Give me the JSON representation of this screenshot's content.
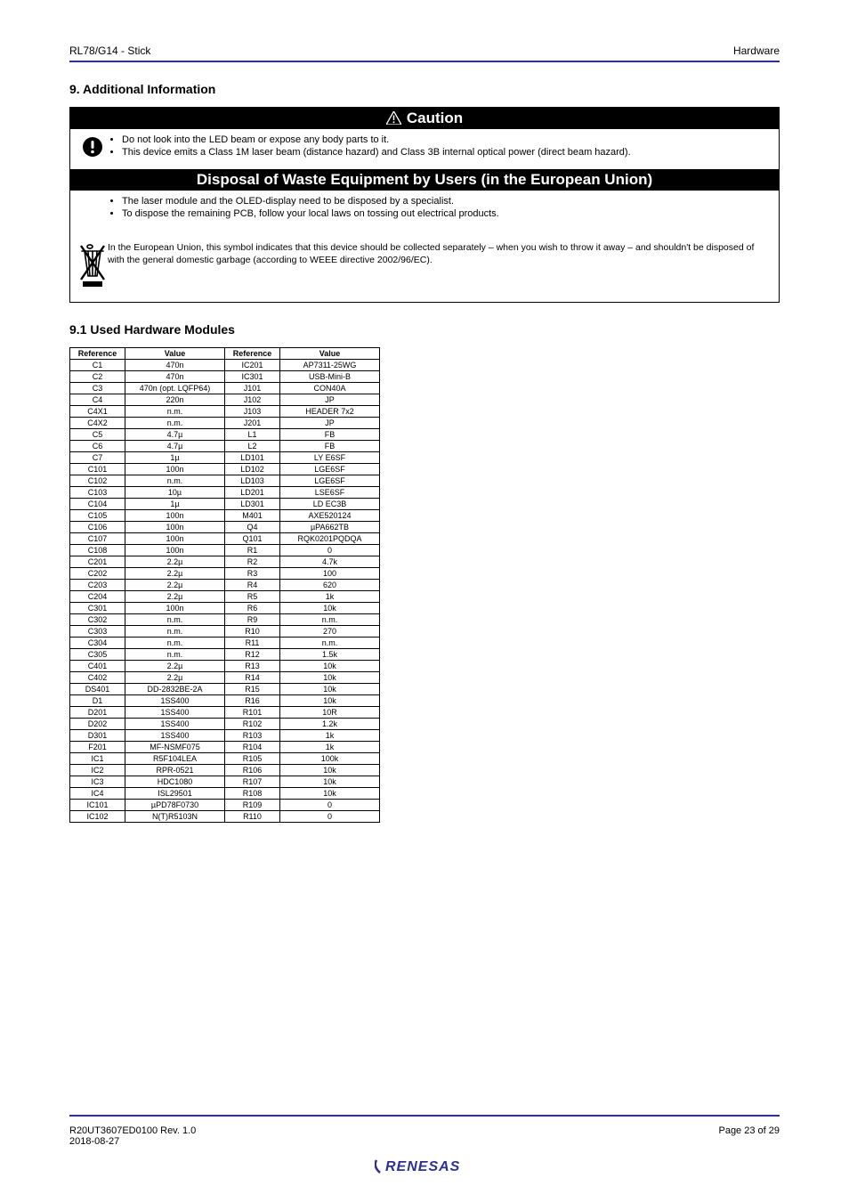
{
  "header": {
    "left": "RL78/G14 - Stick",
    "right": "Hardware"
  },
  "section9": {
    "title": "9. Additional Information",
    "caution_bar": "Caution",
    "caution_items": [
      "Do not look into the LED beam or expose any body parts to it.",
      "This device emits a Class 1M laser beam (distance hazard) and Class 3B internal optical power (direct beam hazard)."
    ],
    "disposal_bar": "Disposal of Waste Equipment by Users (in the European Union)",
    "disposal_items": [
      "The laser module and the OLED-display need to be disposed by a specialist.",
      "To dispose the remaining PCB, follow your local laws on tossing out electrical products."
    ],
    "weee_text": "In the European Union, this symbol indicates that this device should be collected separately – when you wish to throw it away – and shouldn't be disposed of with the general domestic garbage (according to WEEE directive 2002/96/EC)."
  },
  "section91": {
    "title": "9.1 Used Hardware Modules",
    "table_head": [
      "Reference",
      "Value",
      "Reference",
      "Value"
    ],
    "rows": [
      [
        "C1",
        "470n",
        "IC201",
        "AP7311-25WG"
      ],
      [
        "C2",
        "470n",
        "IC301",
        "USB-Mini-B"
      ],
      [
        "C3",
        "470n (opt. LQFP64)",
        "J101",
        "CON40A"
      ],
      [
        "C4",
        "220n",
        "J102",
        "JP"
      ],
      [
        "C4X1",
        "n.m.",
        "J103",
        "HEADER 7x2"
      ],
      [
        "C4X2",
        "n.m.",
        "J201",
        "JP"
      ],
      [
        "C5",
        "4.7µ",
        "L1",
        "FB"
      ],
      [
        "C6",
        "4.7µ",
        "L2",
        "FB"
      ],
      [
        "C7",
        "1µ",
        "LD101",
        "LY E6SF"
      ],
      [
        "C101",
        "100n",
        "LD102",
        "LGE6SF"
      ],
      [
        "C102",
        "n.m.",
        "LD103",
        "LGE6SF"
      ],
      [
        "C103",
        "10µ",
        "LD201",
        "LSE6SF"
      ],
      [
        "C104",
        "1µ",
        "LD301",
        "LD EC3B"
      ],
      [
        "C105",
        "100n",
        "M401",
        "AXE520124"
      ],
      [
        "C106",
        "100n",
        "Q4",
        "µPA662TB"
      ],
      [
        "C107",
        "100n",
        "Q101",
        "RQK0201PQDQA"
      ],
      [
        "C108",
        "100n",
        "R1",
        "0"
      ],
      [
        "C201",
        "2.2µ",
        "R2",
        "4.7k"
      ],
      [
        "C202",
        "2.2µ",
        "R3",
        "100"
      ],
      [
        "C203",
        "2.2µ",
        "R4",
        "620"
      ],
      [
        "C204",
        "2.2µ",
        "R5",
        "1k"
      ],
      [
        "C301",
        "100n",
        "R6",
        "10k"
      ],
      [
        "C302",
        "n.m.",
        "R9",
        "n.m."
      ],
      [
        "C303",
        "n.m.",
        "R10",
        "270"
      ],
      [
        "C304",
        "n.m.",
        "R11",
        "n.m."
      ],
      [
        "C305",
        "n.m.",
        "R12",
        "1.5k"
      ],
      [
        "C401",
        "2.2µ",
        "R13",
        "10k"
      ],
      [
        "C402",
        "2.2µ",
        "R14",
        "10k"
      ],
      [
        "DS401",
        "DD-2832BE-2A",
        "R15",
        "10k"
      ],
      [
        "D1",
        "1SS400",
        "R16",
        "10k"
      ],
      [
        "D201",
        "1SS400",
        "R101",
        "10R"
      ],
      [
        "D202",
        "1SS400",
        "R102",
        "1.2k"
      ],
      [
        "D301",
        "1SS400",
        "R103",
        "1k"
      ],
      [
        "F201",
        "MF-NSMF075",
        "R104",
        "1k"
      ],
      [
        "IC1",
        "R5F104LEA",
        "R105",
        "100k"
      ],
      [
        "IC2",
        "RPR-0521",
        "R106",
        "10k"
      ],
      [
        "IC3",
        "HDC1080",
        "R107",
        "10k"
      ],
      [
        "IC4",
        "ISL29501",
        "R108",
        "10k"
      ],
      [
        "IC101",
        "µPD78F0730",
        "R109",
        "0"
      ],
      [
        "IC102",
        "N(T)R5103N",
        "R110",
        "0"
      ]
    ]
  },
  "footer": {
    "left": "R20UT3607ED0100 Rev. 1.0",
    "right": "Page 23 of 29",
    "date": "2018-08-27"
  }
}
